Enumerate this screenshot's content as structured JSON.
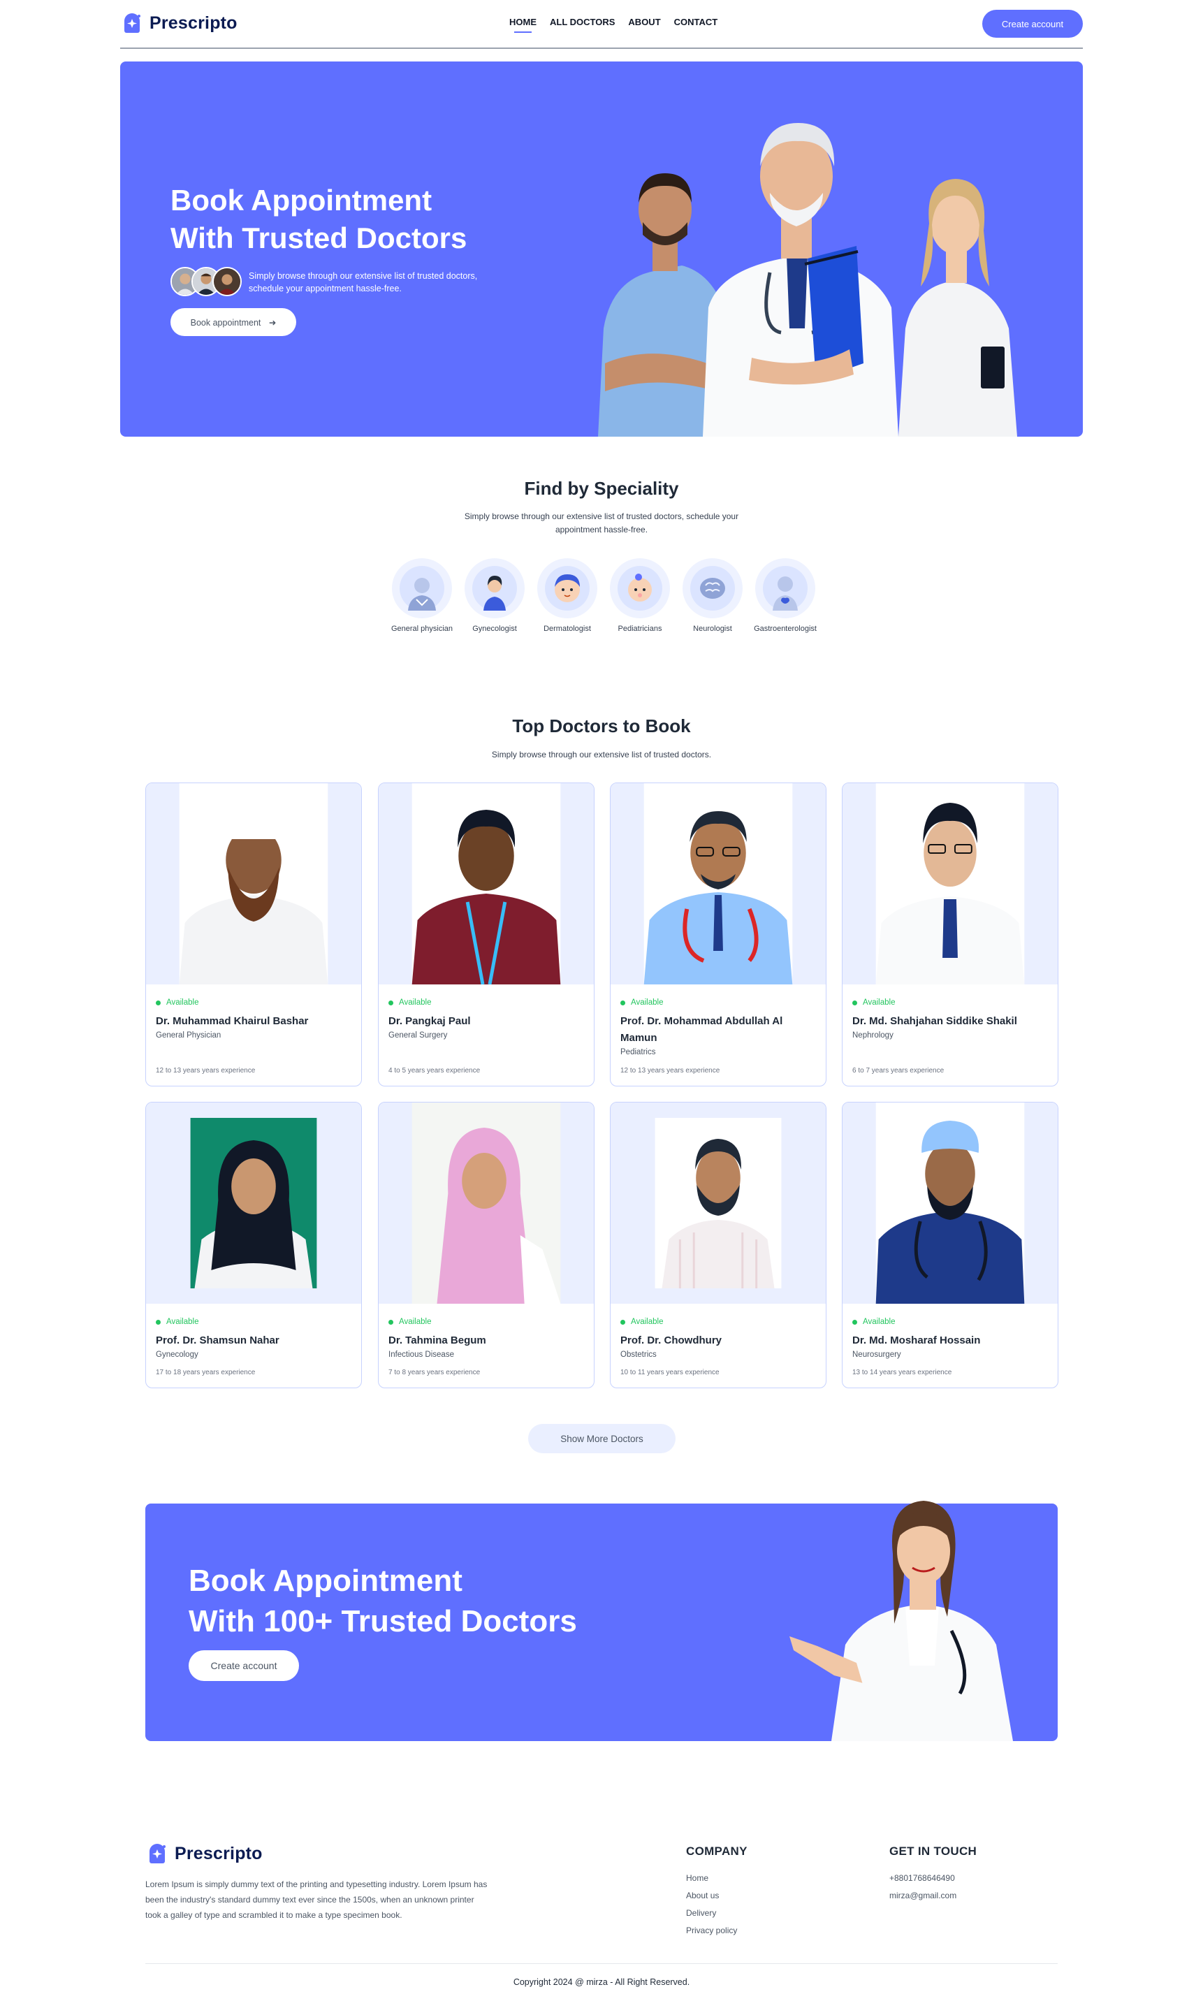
{
  "brand": {
    "name": "Prescripto",
    "accent": "#5f6fff",
    "navy": "#0b1b52"
  },
  "nav": {
    "links": [
      "HOME",
      "ALL DOCTORS",
      "ABOUT",
      "CONTACT"
    ],
    "active": "HOME",
    "cta": "Create account"
  },
  "hero": {
    "title_line1": "Book Appointment",
    "title_line2": "With Trusted Doctors",
    "subtitle": "Simply browse through our extensive list of trusted doctors, schedule your appointment hassle-free.",
    "cta": "Book appointment",
    "cta_icon": "arrow-right-icon"
  },
  "speciality": {
    "title": "Find by Speciality",
    "subtitle": "Simply browse through our extensive list of trusted doctors, schedule your appointment hassle-free.",
    "items": [
      {
        "label": "General physician",
        "icon": "general-physician-icon"
      },
      {
        "label": "Gynecologist",
        "icon": "gynecologist-icon"
      },
      {
        "label": "Dermatologist",
        "icon": "dermatologist-icon"
      },
      {
        "label": "Pediatricians",
        "icon": "pediatricians-icon"
      },
      {
        "label": "Neurologist",
        "icon": "neurologist-icon"
      },
      {
        "label": "Gastroenterologist",
        "icon": "gastroenterologist-icon"
      }
    ]
  },
  "doctors": {
    "title": "Top Doctors to Book",
    "subtitle": "Simply browse through our extensive list of trusted doctors.",
    "list": [
      {
        "status": "Available",
        "name": "Dr. Muhammad Khairul Bashar",
        "speciality": "General Physician",
        "experience": "12 to 13 years years experience"
      },
      {
        "status": "Available",
        "name": "Dr. Pangkaj Paul",
        "speciality": "General Surgery",
        "experience": "4 to 5 years years experience"
      },
      {
        "status": "Available",
        "name": "Prof. Dr. Mohammad Abdullah Al Mamun",
        "speciality": "Pediatrics",
        "experience": "12 to 13 years years experience"
      },
      {
        "status": "Available",
        "name": "Dr. Md. Shahjahan Siddike Shakil",
        "speciality": "Nephrology",
        "experience": "6 to 7 years years experience"
      },
      {
        "status": "Available",
        "name": "Prof. Dr. Shamsun Nahar",
        "speciality": "Gynecology",
        "experience": "17 to 18 years years experience"
      },
      {
        "status": "Available",
        "name": "Dr. Tahmina Begum",
        "speciality": "Infectious Disease",
        "experience": "7 to 8 years years experience"
      },
      {
        "status": "Available",
        "name": "Prof. Dr. Chowdhury",
        "speciality": "Obstetrics",
        "experience": "10 to 11 years years experience"
      },
      {
        "status": "Available",
        "name": "Dr. Md. Mosharaf Hossain",
        "speciality": "Neurosurgery",
        "experience": "13 to 14 years years experience"
      }
    ],
    "more_button": "Show More Doctors"
  },
  "banner": {
    "title_line1": "Book Appointment",
    "title_line2": "With 100+ Trusted Doctors",
    "cta": "Create account"
  },
  "footer": {
    "brand": "Prescripto",
    "description": "Lorem Ipsum is simply dummy text of the printing and typesetting industry. Lorem Ipsum has been the industry's standard dummy text ever since the 1500s, when an unknown printer took a galley of type and scrambled it to make a type specimen book.",
    "company": {
      "title": "COMPANY",
      "links": [
        "Home",
        "About us",
        "Delivery",
        "Privacy policy"
      ]
    },
    "contact": {
      "title": "GET IN TOUCH",
      "phone": "+8801768646490",
      "email": "mirza@gmail.com"
    },
    "copyright": "Copyright 2024 @ mirza - All Right Reserved."
  }
}
